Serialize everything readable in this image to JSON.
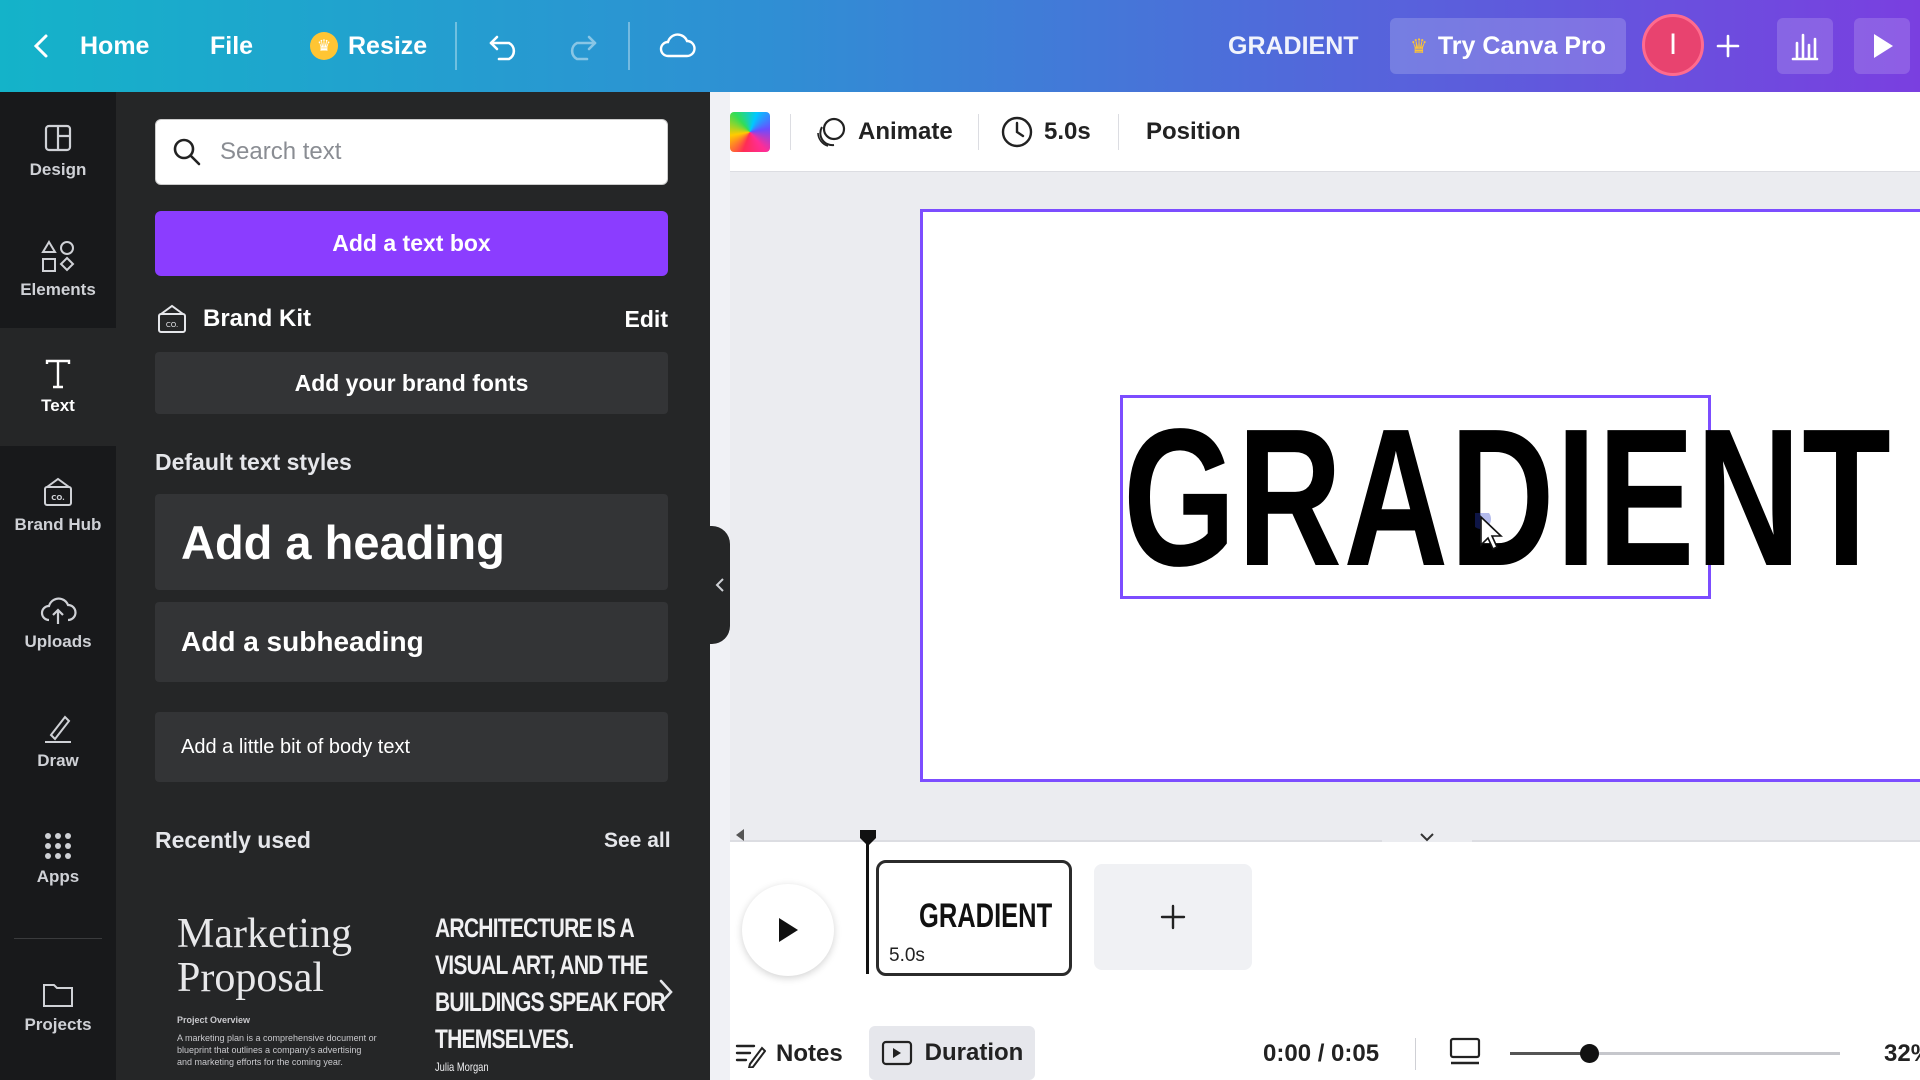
{
  "topbar": {
    "home_label": "Home",
    "file_label": "File",
    "resize_label": "Resize",
    "doc_title": "GRADIENT",
    "pro_label": "Try Canva Pro",
    "avatar_initial": "I"
  },
  "rail": {
    "items": [
      {
        "label": "Design",
        "icon": "layout-icon"
      },
      {
        "label": "Elements",
        "icon": "shapes-icon"
      },
      {
        "label": "Text",
        "icon": "text-icon"
      },
      {
        "label": "Brand Hub",
        "icon": "brand-icon"
      },
      {
        "label": "Uploads",
        "icon": "upload-cloud-icon"
      },
      {
        "label": "Draw",
        "icon": "draw-icon"
      },
      {
        "label": "Apps",
        "icon": "apps-grid-icon"
      },
      {
        "label": "Projects",
        "icon": "folder-icon"
      }
    ],
    "active": "Text"
  },
  "panel": {
    "search_placeholder": "Search text",
    "add_textbox_label": "Add a text box",
    "brand_kit_label": "Brand Kit",
    "brand_kit_edit": "Edit",
    "brand_fonts_label": "Add your brand fonts",
    "default_styles_title": "Default text styles",
    "heading_label": "Add a heading",
    "subheading_label": "Add a subheading",
    "body_label": "Add a little bit of body text",
    "recent_title": "Recently used",
    "see_all": "See all",
    "recent": {
      "card1_title_line1": "Marketing",
      "card1_title_line2": "Proposal",
      "card1_sub_title": "Project Overview",
      "card1_sub_text": "A marketing plan is a comprehensive document or blueprint that outlines a company's advertising and marketing efforts for the coming year.",
      "card2_lines": [
        "ARCHITECTURE IS A",
        "VISUAL ART, AND THE",
        "BUILDINGS SPEAK FOR",
        "THEMSELVES."
      ],
      "card2_sig": "Julia Morgan"
    }
  },
  "context_bar": {
    "animate_label": "Animate",
    "duration_label": "5.0s",
    "position_label": "Position"
  },
  "canvas": {
    "text": "GRADIENT"
  },
  "timeline": {
    "page_text": "GRADIENT",
    "page_duration": "5.0s",
    "notes_label": "Notes",
    "duration_label": "Duration",
    "time": "0:00 / 0:05",
    "zoom_fraction": 0.24,
    "zoom_label": "32%"
  },
  "colors": {
    "accent": "#8b3dff",
    "selection": "#7c4dff",
    "panel_bg": "#252627",
    "rail_bg": "#18191b"
  }
}
